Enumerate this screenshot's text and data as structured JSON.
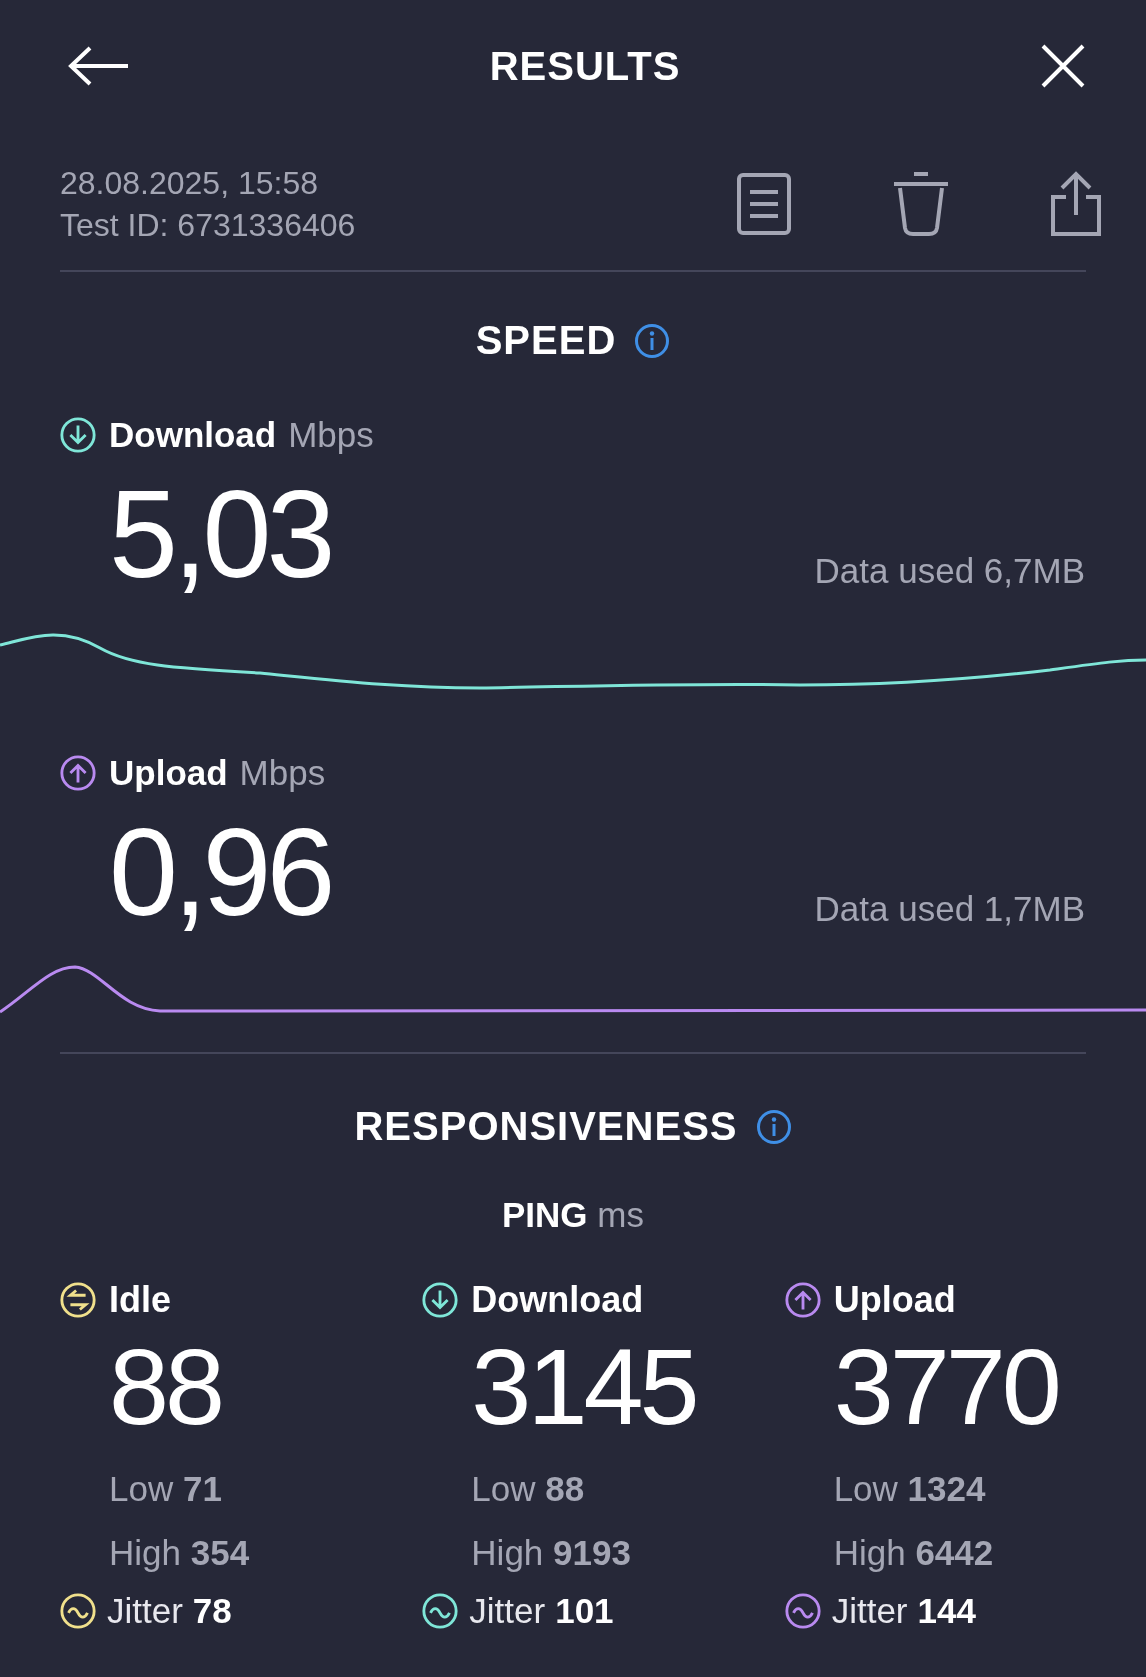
{
  "header": {
    "title": "RESULTS"
  },
  "test": {
    "date": "28.08.2025, 15:58",
    "id": "Test ID: 6731336406"
  },
  "speed": {
    "title": "SPEED",
    "metrics": [
      {
        "kind": "download",
        "label": "Download",
        "unit": "Mbps",
        "value": "5,03",
        "data_used": "Data used 6,7MB"
      },
      {
        "kind": "upload",
        "label": "Upload",
        "unit": "Mbps",
        "value": "0,96",
        "data_used": "Data used 1,7MB"
      }
    ]
  },
  "responsiveness": {
    "title": "RESPONSIVENESS",
    "ping_label": "PING",
    "ping_unit": "ms",
    "columns": [
      {
        "kind": "idle",
        "label": "Idle",
        "value": "88",
        "low_label": "Low",
        "low": "71",
        "high_label": "High",
        "high": "354",
        "jitter_label": "Jitter",
        "jitter": "78"
      },
      {
        "kind": "download",
        "label": "Download",
        "value": "3145",
        "low_label": "Low",
        "low": "88",
        "high_label": "High",
        "high": "9193",
        "jitter_label": "Jitter",
        "jitter": "101"
      },
      {
        "kind": "upload",
        "label": "Upload",
        "value": "3770",
        "low_label": "Low",
        "low": "1324",
        "high_label": "High",
        "high": "6442",
        "jitter_label": "Jitter",
        "jitter": "144"
      }
    ]
  }
}
